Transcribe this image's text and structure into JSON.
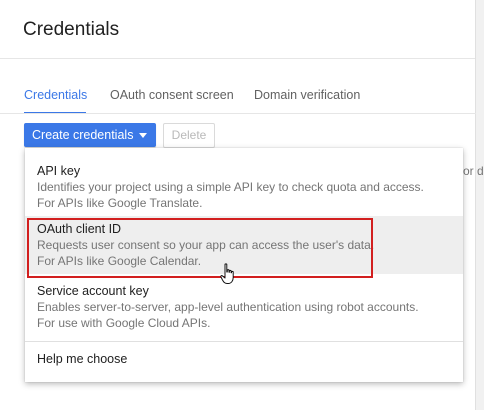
{
  "page": {
    "title": "Credentials"
  },
  "tabs": [
    {
      "label": "Credentials",
      "active": true
    },
    {
      "label": "OAuth consent screen",
      "active": false
    },
    {
      "label": "Domain verification",
      "active": false
    }
  ],
  "toolbar": {
    "create_label": "Create credentials",
    "delete_label": "Delete"
  },
  "clipped_text": "or d",
  "menu": {
    "items": [
      {
        "title": "API key",
        "desc_line1": "Identifies your project using a simple API key to check quota and access.",
        "desc_line2": "For APIs like Google Translate."
      },
      {
        "title": "OAuth client ID",
        "desc_line1": "Requests user consent so your app can access the user's data.",
        "desc_line2": "For APIs like Google Calendar."
      },
      {
        "title": "Service account key",
        "desc_line1": "Enables server-to-server, app-level authentication using robot accounts.",
        "desc_line2": "For use with Google Cloud APIs."
      },
      {
        "title": "Help me choose"
      }
    ]
  },
  "colors": {
    "accent": "#3b78e7",
    "highlight_box": "#d21f1f",
    "hover_bg": "#eeeeee"
  },
  "icons": {
    "dropdown_caret": "caret-down-icon",
    "pointer_cursor": "hand-pointer-icon"
  }
}
